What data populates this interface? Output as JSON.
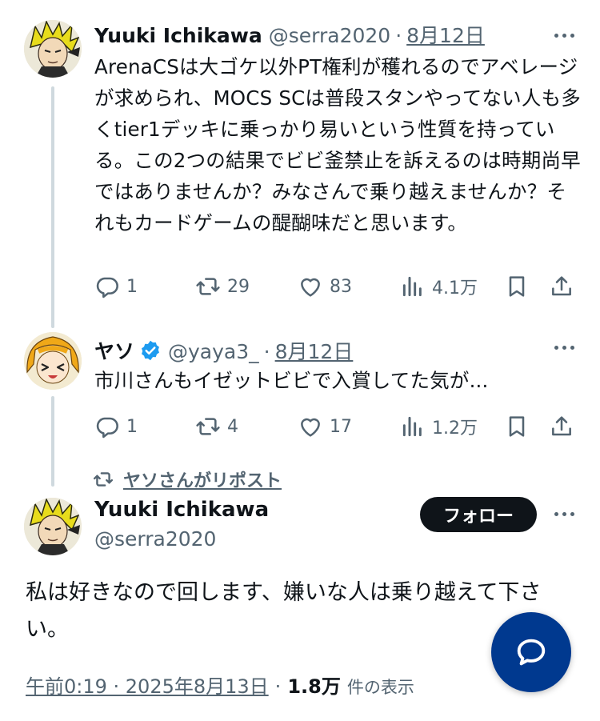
{
  "tweets": [
    {
      "name": "Yuuki Ichikawa",
      "handle": "@serra2020",
      "sep": "·",
      "date": "8月12日",
      "text": "ArenaCSは大ゴケ以外PT権利が穫れるのでアベレージが求められ、MOCS SCは普段スタンやってない人も多くtier1デッキに乗っかり易いという性質を持っている。この2つの結果でビビ釜禁止を訴えるのは時期尚早ではありませんか？みなさんで乗り越えませんか？それもカードゲームの醍醐味だと思います。",
      "actions": {
        "replies": "1",
        "reposts": "29",
        "likes": "83",
        "views": "4.1万"
      }
    },
    {
      "name": "ヤソ",
      "handle": "@yaya3_",
      "sep": "·",
      "date": "8月12日",
      "verified": true,
      "text": "市川さんもイゼットビビで入賞してた気が...",
      "actions": {
        "replies": "1",
        "reposts": "4",
        "likes": "17",
        "views": "1.2万"
      }
    }
  ],
  "repost_label": "ヤソさんがリポスト",
  "main": {
    "name": "Yuuki Ichikawa",
    "handle": "@serra2020",
    "follow_label": "フォロー",
    "text": "私は好きなので回します、嫌いな人は乗り越えて下さい。",
    "timestamp": "午前0:19 · 2025年8月13日",
    "sep": "·",
    "views": "1.8万",
    "views_label": "件の表示"
  },
  "icons": {
    "reply": "reply-icon",
    "repost": "repost-icon",
    "like": "heart-icon",
    "views": "analytics-icon",
    "bookmark": "bookmark-icon",
    "share": "share-icon",
    "more": "more-icon",
    "compose": "new-message-icon"
  },
  "colors": {
    "text": "#0f1419",
    "secondary": "#536471",
    "verified": "#1d9bf0",
    "fab": "#00398f",
    "follow_bg": "#0f1419"
  }
}
